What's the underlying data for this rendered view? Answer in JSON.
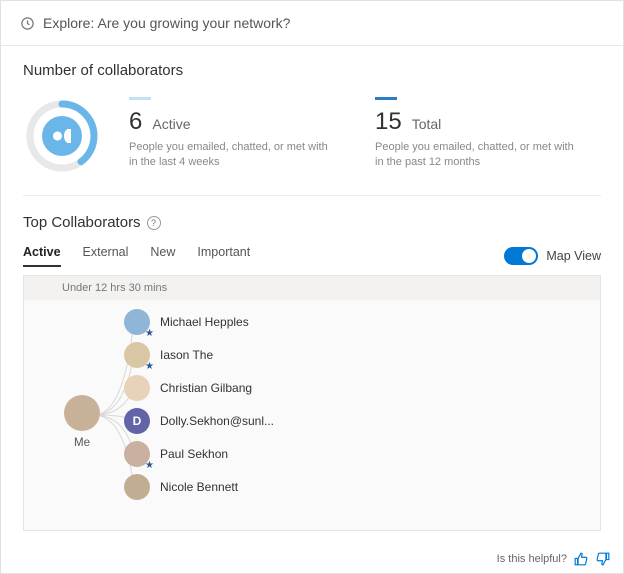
{
  "header": {
    "icon": "history-icon",
    "title": "Explore: Are you growing your network?"
  },
  "collaborators": {
    "section_title": "Number of collaborators",
    "active": {
      "value": "6",
      "label": "Active",
      "description": "People you emailed, chatted, or met with in the last 4 weeks"
    },
    "total": {
      "value": "15",
      "label": "Total",
      "description": "People you emailed, chatted, or met with in the past 12 months"
    }
  },
  "top_collaborators": {
    "title": "Top Collaborators",
    "tabs": {
      "active": "Active",
      "external": "External",
      "new": "New",
      "important": "Important"
    },
    "map_view_label": "Map View",
    "graph_header": "Under 12 hrs 30 mins",
    "me_label": "Me",
    "people": [
      {
        "name": "Michael Hepples",
        "color": "#8fb5d7",
        "starred": true
      },
      {
        "name": "Iason The",
        "color": "#d9c6a5",
        "starred": true
      },
      {
        "name": "Christian Gilbang",
        "color": "#e8d3b9",
        "starred": false
      },
      {
        "name": "Dolly.Sekhon@sunl...",
        "initial": "D",
        "color": "#6264a7",
        "starred": false
      },
      {
        "name": "Paul Sekhon",
        "color": "#c9b0a0",
        "starred": true
      },
      {
        "name": "Nicole Bennett",
        "color": "#c2ad92",
        "starred": false
      }
    ]
  },
  "footer": {
    "helpful_label": "Is this helpful?"
  },
  "colors": {
    "accent": "#0078d4",
    "ring_active": "#6bb6e8",
    "ring_total": "#2b7cc0"
  }
}
